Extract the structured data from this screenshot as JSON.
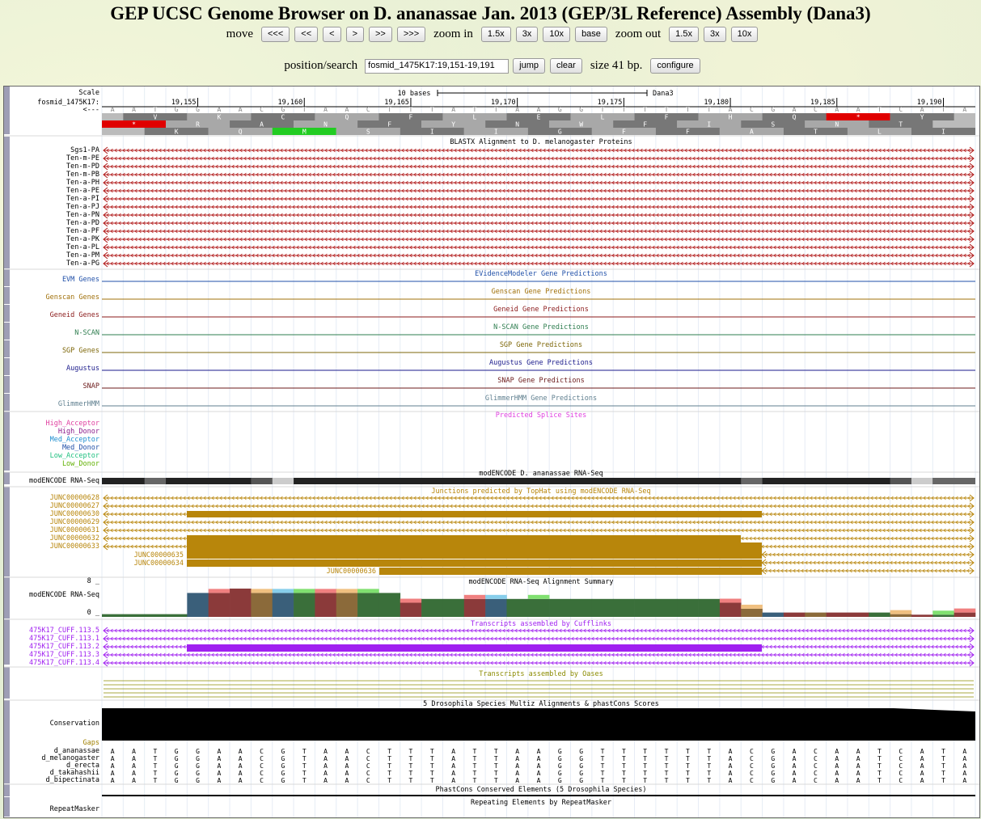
{
  "title": "GEP UCSC Genome Browser on D. ananassae Jan. 2013 (GEP/3L Reference) Assembly (Dana3)",
  "nav": {
    "move_label": "move",
    "move_buttons": [
      "<<<",
      "<<",
      "<",
      ">",
      ">>",
      ">>>"
    ],
    "zoom_in_label": "zoom in",
    "zoom_in_buttons": [
      "1.5x",
      "3x",
      "10x",
      "base"
    ],
    "zoom_out_label": "zoom out",
    "zoom_out_buttons": [
      "1.5x",
      "3x",
      "10x"
    ]
  },
  "position": {
    "label": "position/search",
    "value": "fosmid_1475K17:19,151-19,191",
    "jump": "jump",
    "clear": "clear",
    "size_text": "size 41 bp.",
    "configure": "configure"
  },
  "ruler": {
    "scale_label": "Scale",
    "chrom_label": "fosmid_1475K17:",
    "strand_label": "<---",
    "scale_text": "10 bases",
    "assembly": "Dana3",
    "ticks": [
      "19,155",
      "19,160",
      "19,165",
      "19,170",
      "19,175",
      "19,180",
      "19,185",
      "19,190"
    ],
    "sequence": "AATGGAACGTAACTTTATTAAGGTTTTTTACGACAATCATA",
    "frame1": [
      "V",
      "K",
      "C",
      "Q",
      "F",
      "L",
      "E",
      "L",
      "F",
      "H",
      "Q",
      "*",
      "Y"
    ],
    "frame2": [
      "*",
      "R",
      "A",
      "N",
      "F",
      "Y",
      "N",
      "W",
      "F",
      "I",
      "S",
      "N",
      "T",
      "Y"
    ],
    "frame3": [
      "K",
      "Q",
      "M",
      "S",
      "I",
      "I",
      "G",
      "F",
      "F",
      "A",
      "T",
      "L",
      "I"
    ]
  },
  "blastx": {
    "title": "BLASTX Alignment to D. melanogaster Proteins",
    "rows": [
      "Sgs1-PA",
      "Ten-m-PE",
      "Ten-m-PD",
      "Ten-m-PB",
      "Ten-a-PH",
      "Ten-a-PE",
      "Ten-a-PI",
      "Ten-a-PJ",
      "Ten-a-PN",
      "Ten-a-PD",
      "Ten-a-PF",
      "Ten-a-PK",
      "Ten-a-PL",
      "Ten-a-PM",
      "Ten-a-PG"
    ]
  },
  "gene_tracks": [
    {
      "label": "EVM Genes",
      "title": "EVidenceModeler Gene Predictions",
      "color": "#1f4fa8"
    },
    {
      "label": "Genscan Genes",
      "title": "Genscan Gene Predictions",
      "color": "#a0700a"
    },
    {
      "label": "Geneid Genes",
      "title": "Geneid Gene Predictions",
      "color": "#8b1a1a"
    },
    {
      "label": "N-SCAN",
      "title": "N-SCAN Gene Predictions",
      "color": "#2e7d4f"
    },
    {
      "label": "SGP Genes",
      "title": "SGP Gene Predictions",
      "color": "#7d6608"
    },
    {
      "label": "Augustus",
      "title": "Augustus Gene Predictions",
      "color": "#1a1a8b"
    },
    {
      "label": "SNAP",
      "title": "SNAP Gene Predictions",
      "color": "#6b1a1a"
    },
    {
      "label": "GlimmerHMM",
      "title": "GlimmerHMM Gene Predictions",
      "color": "#5f7f8f"
    }
  ],
  "splice": {
    "title": "Predicted Splice Sites",
    "labels": [
      {
        "text": "High_Acceptor",
        "color": "#e040a0"
      },
      {
        "text": "High_Donor",
        "color": "#8b1a8b"
      },
      {
        "text": "Med_Acceptor",
        "color": "#1f8fd0"
      },
      {
        "text": "Med_Donor",
        "color": "#1f4fa8"
      },
      {
        "text": "Low_Acceptor",
        "color": "#20c080"
      },
      {
        "text": "Low_Donor",
        "color": "#60b000"
      }
    ]
  },
  "rnaseq": {
    "title": "modENCODE D. ananassae RNA-Seq",
    "label": "modENCODE RNA-Seq"
  },
  "junctions": {
    "title": "Junctions predicted by TopHat using modENCODE RNA-Seq",
    "rows": [
      "JUNC00000628",
      "JUNC00000627",
      "JUNC00000630",
      "JUNC00000629",
      "JUNC00000631",
      "JUNC00000632",
      "JUNC00000633"
    ],
    "inline": [
      "JUNC00000635",
      "JUNC00000634",
      "JUNC00000636"
    ],
    "color": "#b8860b"
  },
  "summary": {
    "title": "modENCODE RNA-Seq Alignment Summary",
    "label": "modENCODE RNA-Seq",
    "ymax": "8 _",
    "ymin": "0 _"
  },
  "cufflinks": {
    "title": "Transcripts assembled by Cufflinks",
    "rows": [
      "475K17_CUFF.113.5",
      "475K17_CUFF.113.1",
      "475K17_CUFF.113.2",
      "475K17_CUFF.113.3",
      "475K17_CUFF.113.4"
    ],
    "color": "#a020f0"
  },
  "oases": {
    "title": "Transcripts assembled by Oases"
  },
  "multiz": {
    "title": "5 Drosophila Species Multiz Alignments & phastCons Scores",
    "label": "Conservation",
    "gaps_label": "Gaps",
    "species": [
      "d_ananassae",
      "d_melanogaster",
      "d_erecta",
      "d_takahashii",
      "d_bipectinata"
    ]
  },
  "phastcons": {
    "title": "PhastCons Conserved Elements (5 Drosophila Species)"
  },
  "repeatmasker": {
    "title": "Repeating Elements by RepeatMasker",
    "label": "RepeatMasker"
  }
}
